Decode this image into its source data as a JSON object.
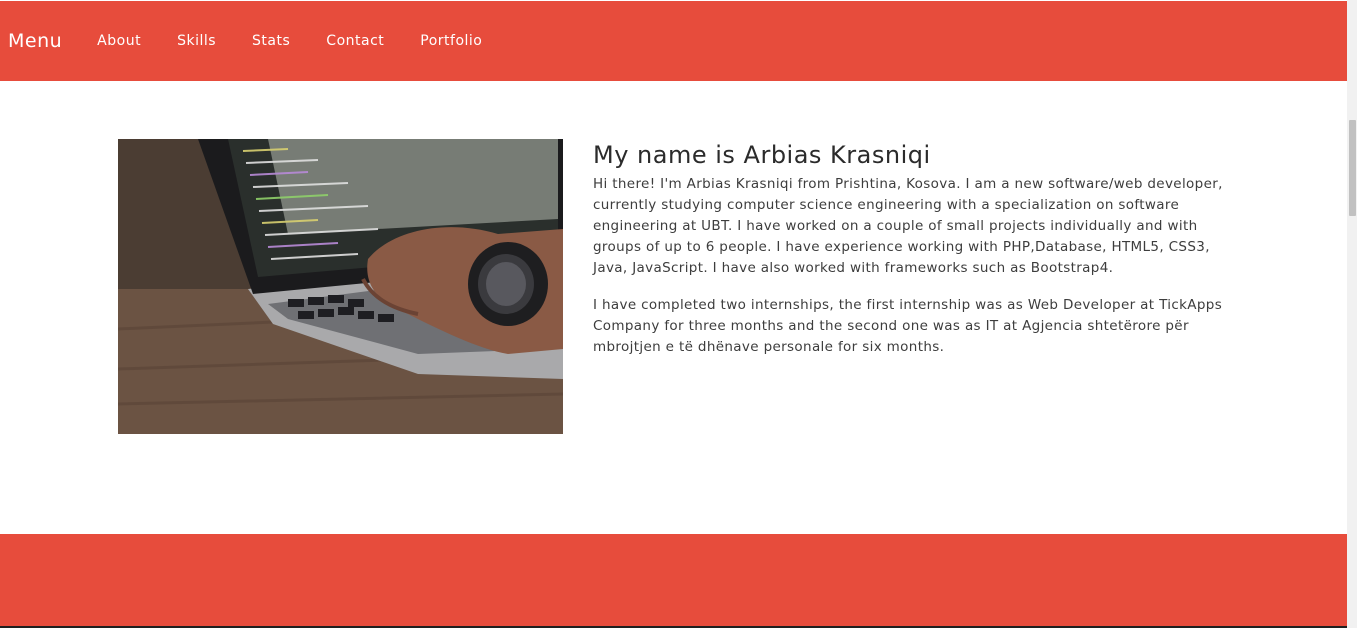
{
  "navbar": {
    "brand": "Menu",
    "links": [
      {
        "label": "About"
      },
      {
        "label": "Skills"
      },
      {
        "label": "Stats"
      },
      {
        "label": "Contact"
      },
      {
        "label": "Portfolio"
      }
    ]
  },
  "about": {
    "title": "My name is Arbias Krasniqi",
    "paragraphs": [
      "Hi there! I'm Arbias Krasniqi from Prishtina, Kosova. I am a new software/web developer, currently studying computer science engineering with a specialization on software engineering at UBT. I have worked on a couple of small projects individually and with groups of up to 6 people. I have experience working with PHP,Database, HTML5, CSS3, Java, JavaScript. I have also worked with frameworks such as Bootstrap4.",
      "I have completed two internships, the first internship was as Web Developer at TickApps Company for three months and the second one was as IT at Agjencia shtetërore për mbrojtjen e të dhënave personale for six months."
    ],
    "image_icon": "laptop-typing-photo"
  },
  "colors": {
    "accent": "#e74c3c",
    "background": "#ffffff",
    "text": "#3d3d3d"
  }
}
